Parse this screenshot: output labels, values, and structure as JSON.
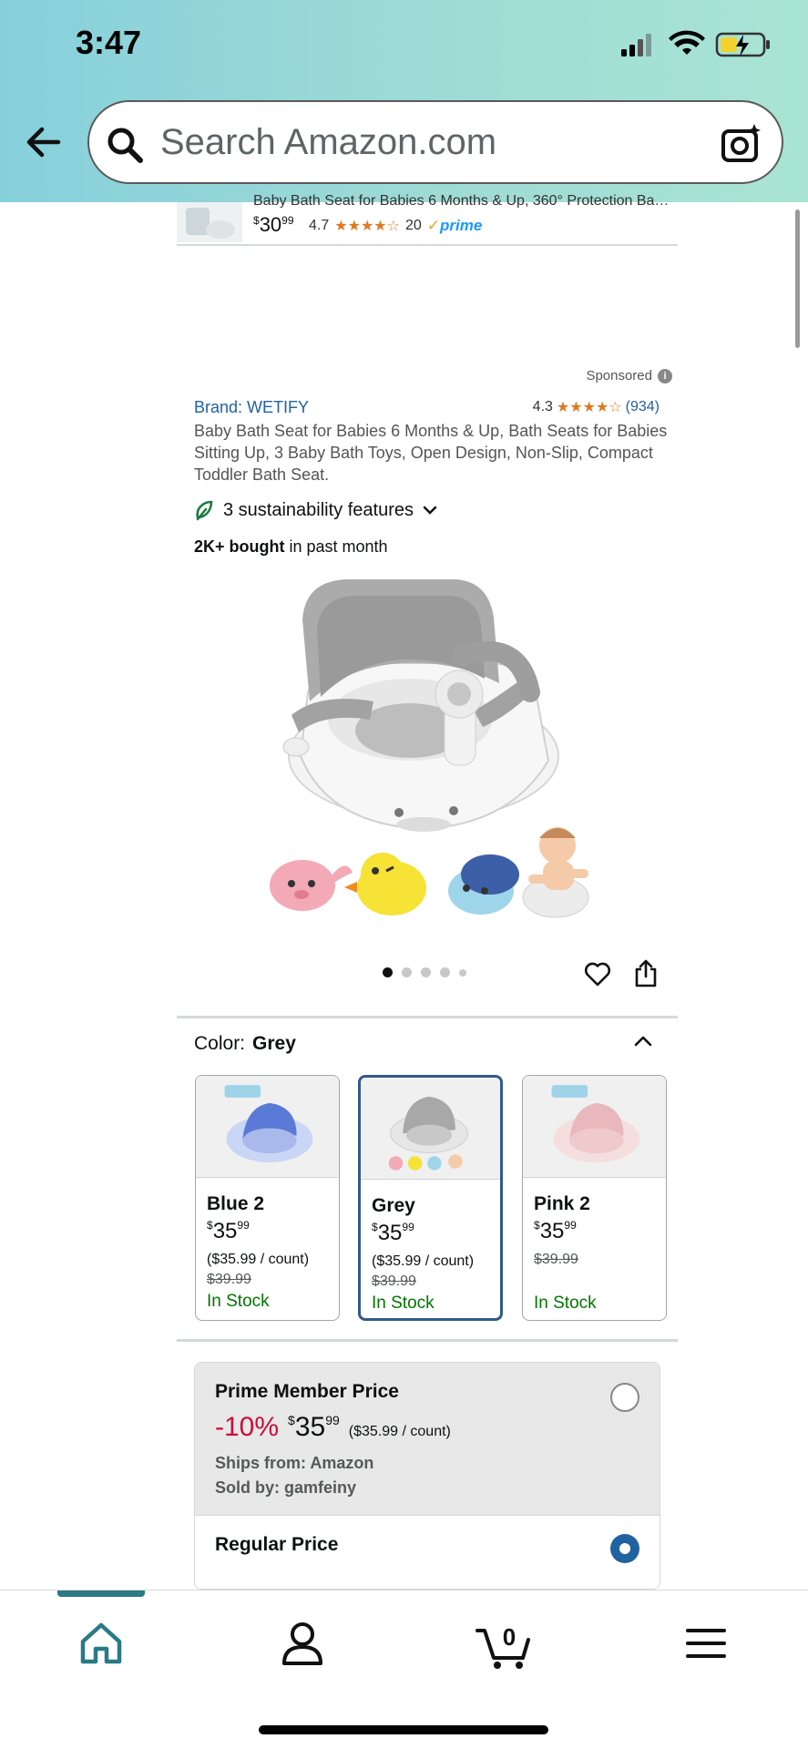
{
  "status_bar": {
    "time": "3:47"
  },
  "search": {
    "placeholder": "Search Amazon.com"
  },
  "prev_result": {
    "title": "Baby Bath Seat for Babies 6 Months & Up, 360° Protection Ba…",
    "price_currency": "$",
    "price_whole": "30",
    "price_cents": "99",
    "rating": "4.7",
    "stars": "★★★★☆",
    "reviews": "20",
    "prime_label": "prime"
  },
  "product": {
    "sponsored_label": "Sponsored",
    "brand": "Brand: WETIFY",
    "rating": "4.3",
    "stars": "★★★★☆",
    "review_count": "(934)",
    "title": "Baby Bath Seat for Babies 6 Months & Up, Bath Seats for Babies Sitting Up, 3 Baby Bath Toys, Open Design, Non-Slip, Compact Toddler Bath Seat.",
    "sustainability": "3 sustainability features",
    "bought_bold": "2K+ bought",
    "bought_rest": " in past month",
    "image_count": 5,
    "active_image": 1
  },
  "color_selector": {
    "label": "Color:",
    "selected": "Grey",
    "options": [
      {
        "name": "Blue 2",
        "currency": "$",
        "price_whole": "35",
        "price_cents": "99",
        "unit": "($35.99 / count)",
        "list_price": "$39.99",
        "stock": "In Stock"
      },
      {
        "name": "Grey",
        "currency": "$",
        "price_whole": "35",
        "price_cents": "99",
        "unit": "($35.99 / count)",
        "list_price": "$39.99",
        "stock": "In Stock"
      },
      {
        "name": "Pink 2",
        "currency": "$",
        "price_whole": "35",
        "price_cents": "99",
        "unit": "",
        "list_price": "$39.99",
        "stock": "In Stock"
      }
    ]
  },
  "price_options": {
    "prime": {
      "title": "Prime Member Price",
      "discount": "-10%",
      "currency": "$",
      "price_whole": "35",
      "price_cents": "99",
      "unit": "($35.99 / count)",
      "ships_from": "Ships from: Amazon",
      "sold_by": "Sold by: gamfeiny"
    },
    "regular": {
      "title": "Regular Price"
    }
  },
  "bottom_nav": {
    "cart_count": "0",
    "active": "home"
  },
  "colors": {
    "accent": "#2162a1",
    "deal_red": "#cc0c39",
    "stock_green": "#007600",
    "nav_active": "#2a7a86"
  }
}
